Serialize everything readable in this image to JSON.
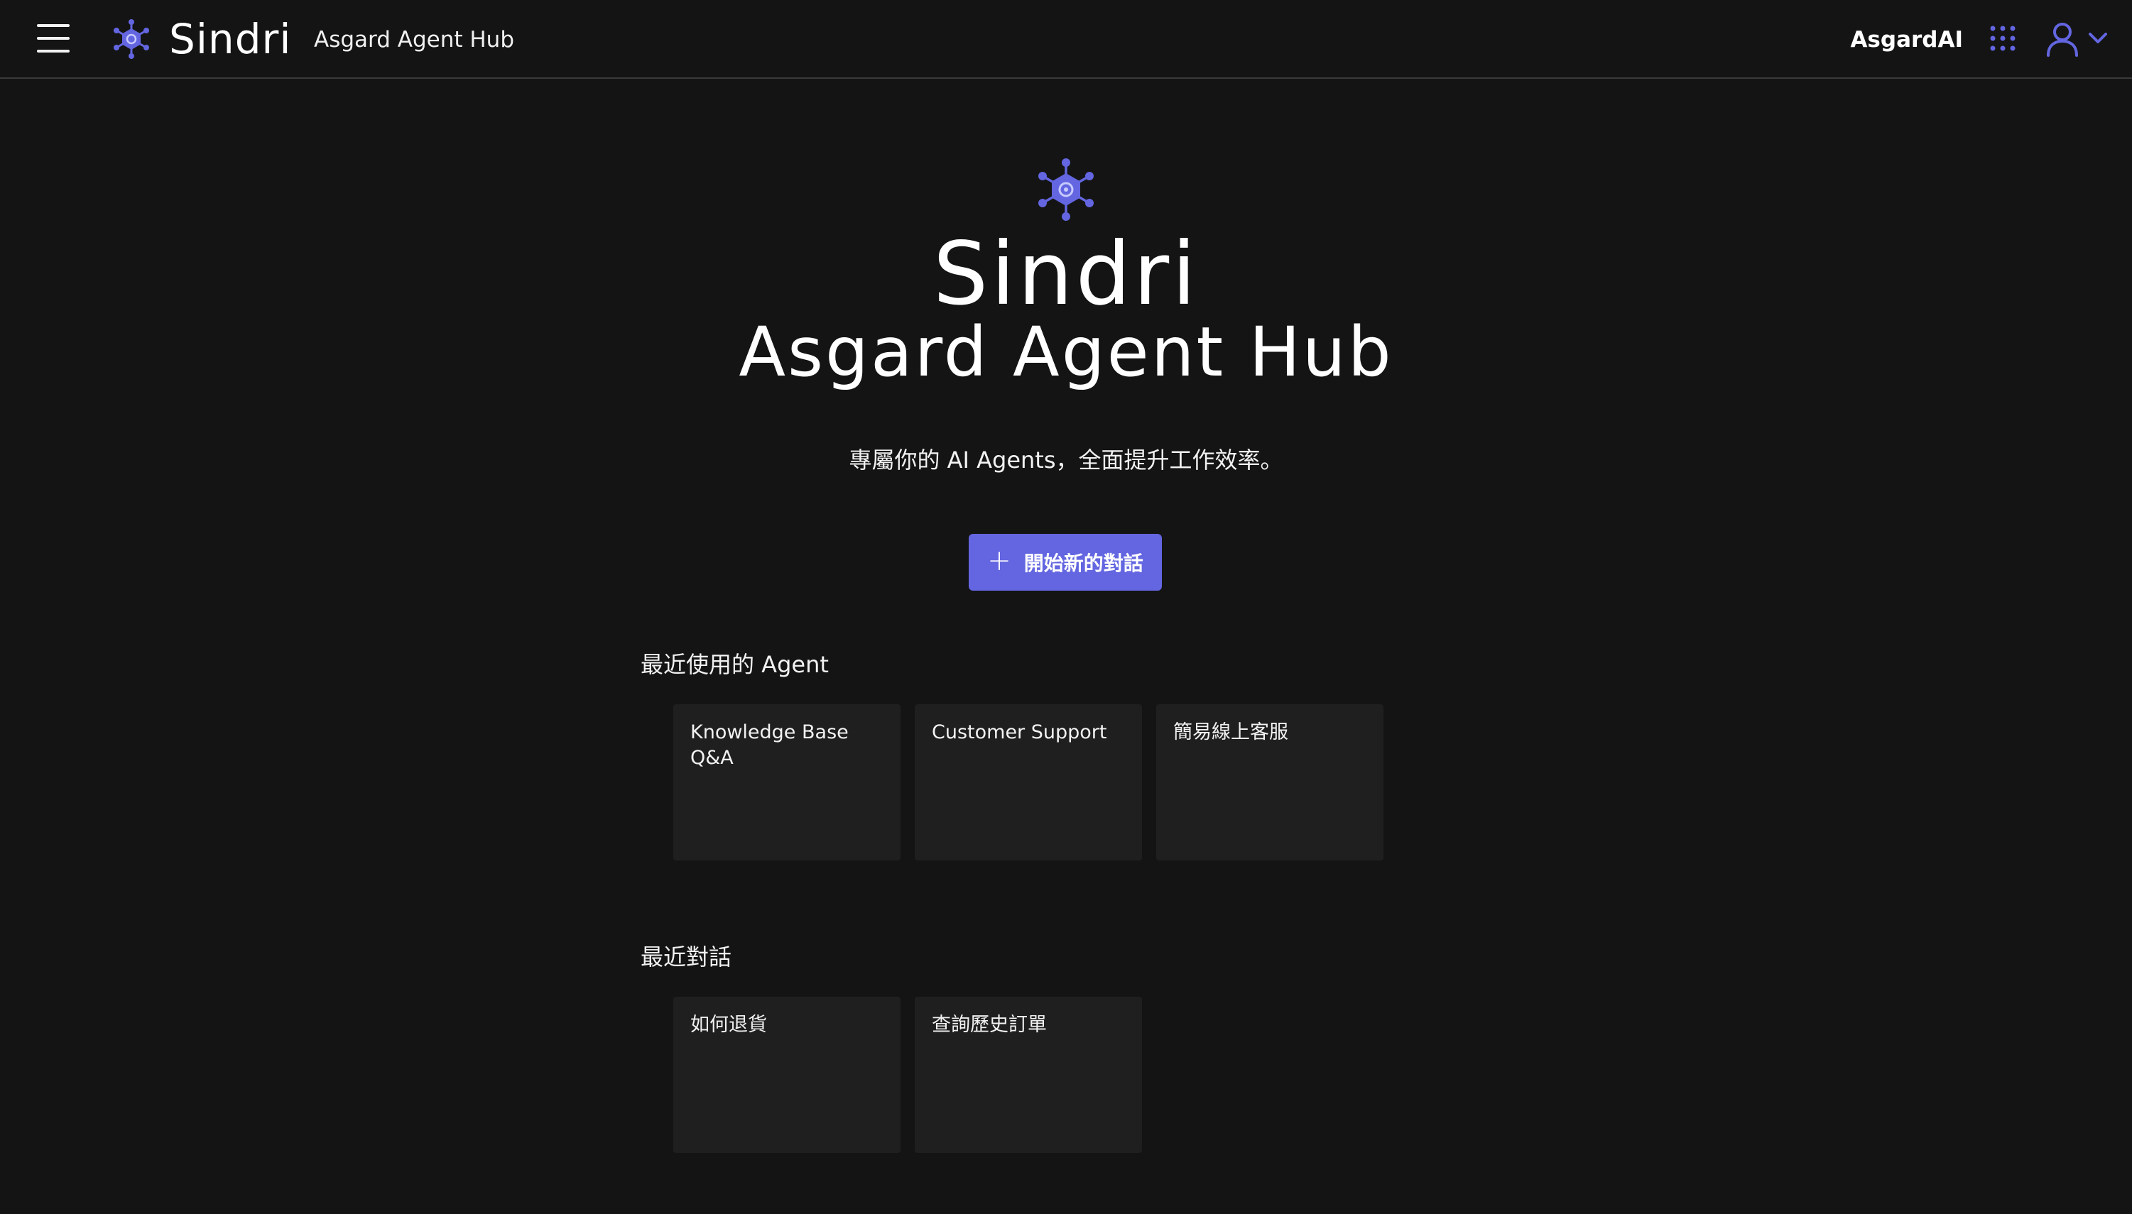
{
  "header": {
    "menu_icon": "hamburger-menu-icon",
    "logo_icon": "hexagon-network-icon",
    "brand": "Sindri",
    "product": "Asgard Agent Hub",
    "org_name": "AsgardAI",
    "apps_icon": "grid-apps-icon",
    "user_icon": "user-icon",
    "chevron_icon": "chevron-down-icon"
  },
  "hero": {
    "icon": "hexagon-network-icon",
    "title": "Sindri",
    "subtitle": "Asgard Agent Hub",
    "tagline": "專屬你的 AI Agents，全面提升工作效率。",
    "new_chat_label": "開始新的對話",
    "new_chat_icon": "plus-icon"
  },
  "recent_agents": {
    "title": "最近使用的 Agent",
    "items": [
      {
        "label": "Knowledge Base Q&A"
      },
      {
        "label": "Customer Support"
      },
      {
        "label": "簡易線上客服"
      }
    ]
  },
  "recent_chats": {
    "title": "最近對話",
    "items": [
      {
        "label": "如何退貨"
      },
      {
        "label": "查詢歷史訂單"
      }
    ]
  },
  "colors": {
    "background": "#141414",
    "accent": "#6366e0",
    "card": "#1f1f1f",
    "text": "#ffffff"
  }
}
